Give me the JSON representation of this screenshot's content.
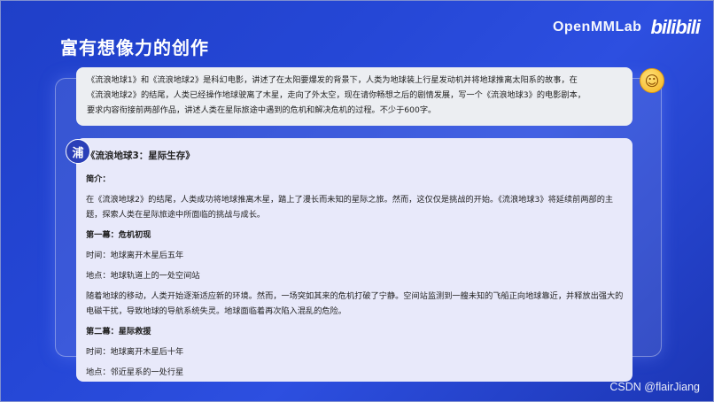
{
  "brand": {
    "text": "OpenMMLab",
    "logo": "bilibili"
  },
  "title": "富有想像力的创作",
  "prompt": {
    "avatar_icon": "smiley-face-icon",
    "lines": [
      "《流浪地球1》和《流浪地球2》是科幻电影，讲述了在太阳要爆发的背景下，人类为地球装上行星发动机并将地球推离太阳系的故事，在",
      "《流浪地球2》的结尾，人类已经操作地球驶离了木星，走向了外太空，现在请你畅想之后的剧情发展，写一个《流浪地球3》的电影剧本，",
      "要求内容衔接前两部作品，讲述人类在星际旅途中遇到的危机和解决危机的过程。不少于600字。"
    ]
  },
  "answer": {
    "avatar_char": "浦",
    "title": "《流浪地球3：星际生存》",
    "intro_heading": "简介：",
    "intro_text": "在《流浪地球2》的结尾，人类成功将地球推离木星，踏上了漫长而未知的星际之旅。然而，这仅仅是挑战的开始。《流浪地球3》将延续前两部的主题，探索人类在星际旅途中所面临的挑战与成长。",
    "act1_heading": "第一幕：危机初现",
    "act1_time": "时间：地球离开木星后五年",
    "act1_place": "地点：地球轨道上的一处空间站",
    "act1_text": "随着地球的移动，人类开始逐渐适应新的环境。然而，一场突如其来的危机打破了宁静。空间站监测到一艘未知的飞船正向地球靠近，并释放出强大的电磁干扰，导致地球的导航系统失灵。地球面临着再次陷入混乱的危险。",
    "act2_heading": "第二幕：星际救援",
    "act2_time": "时间：地球离开木星后十年",
    "act2_place": "地点：邻近星系的一处行星"
  },
  "watermark": "CSDN @flairJiang"
}
